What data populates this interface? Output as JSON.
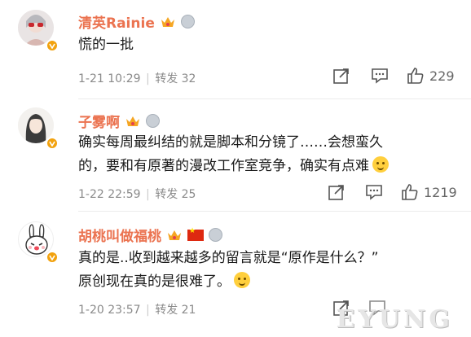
{
  "comments": [
    {
      "username": "清英Rainie",
      "text": "慌的一批",
      "date": "1-21 10:29",
      "forward_label": "转发 32",
      "like_count": "229"
    },
    {
      "username": "子雾啊",
      "text_line1": "确实每周最纠结的就是脚本和分镜了……会想蛮久",
      "text_line2": "的，要和有原著的漫改工作室竞争，确实有点难",
      "date": "1-22 22:59",
      "forward_label": "转发 25",
      "like_count": "1219"
    },
    {
      "username": "胡桃叫做福桃",
      "text_line1": "真的是..收到越来越多的留言就是“原作是什么？”",
      "text_line2": "原创现在真的是很难了。",
      "date": "1-20 23:57",
      "forward_label": "转发 21",
      "like_count": ""
    }
  ],
  "meta_separator": "|",
  "watermark": "EYUNG",
  "colors": {
    "username": "#eb7350",
    "badge": "#f2a20f",
    "meta": "#8a8a8a"
  },
  "icons": [
    "crown-icon",
    "medal-icon",
    "flag-icon",
    "share-icon",
    "comment-icon",
    "like-icon",
    "verified-icon"
  ]
}
